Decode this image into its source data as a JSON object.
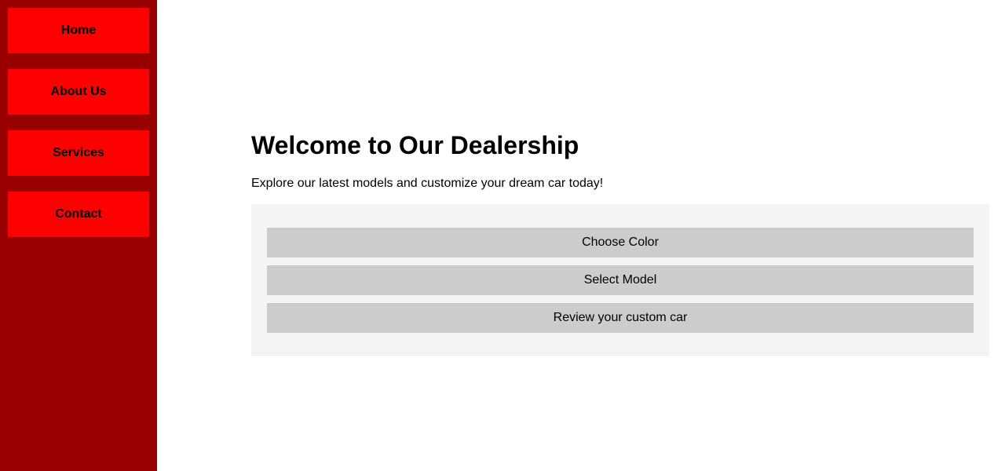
{
  "colors": {
    "sidebar_bg": "#990000",
    "nav_item_bg": "#ff0000",
    "panel_bg": "#f4f4f4",
    "option_bg": "#cccccc",
    "text": "#000000"
  },
  "sidebar": {
    "items": [
      {
        "label": "Home"
      },
      {
        "label": "About Us"
      },
      {
        "label": "Services"
      },
      {
        "label": "Contact"
      }
    ]
  },
  "main": {
    "title": "Welcome to Our Dealership",
    "intro": "Explore our latest models and customize your dream car today!",
    "options": [
      {
        "label": "Choose Color"
      },
      {
        "label": "Select Model"
      },
      {
        "label": "Review your custom car"
      }
    ]
  }
}
